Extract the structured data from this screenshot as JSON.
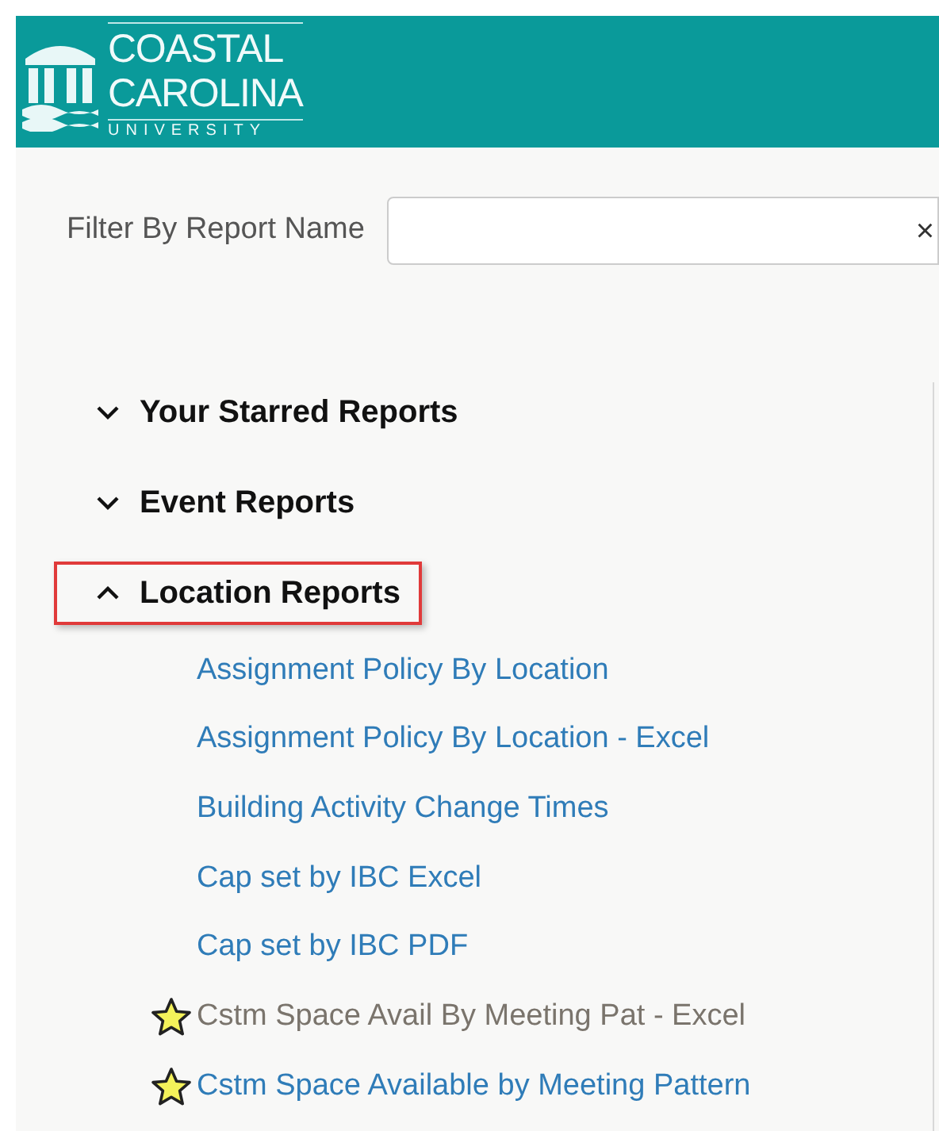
{
  "logo": {
    "lines": [
      "COASTAL",
      "CAROLINA",
      "UNIVERSITY"
    ]
  },
  "filter": {
    "label": "Filter By Report Name",
    "clear": "×"
  },
  "sections": [
    {
      "title": "Your Starred Reports",
      "expanded": false,
      "highlighted": false
    },
    {
      "title": "Event Reports",
      "expanded": false,
      "highlighted": false
    },
    {
      "title": "Location Reports",
      "expanded": true,
      "highlighted": true,
      "reports": [
        {
          "name": "Assignment Policy By Location",
          "starred": false,
          "visited": false
        },
        {
          "name": "Assignment Policy By Location - Excel",
          "starred": false,
          "visited": false
        },
        {
          "name": "Building Activity Change Times",
          "starred": false,
          "visited": false
        },
        {
          "name": "Cap set by IBC Excel",
          "starred": false,
          "visited": false
        },
        {
          "name": "Cap set by IBC PDF",
          "starred": false,
          "visited": false
        },
        {
          "name": "Cstm Space Avail By Meeting Pat - Excel",
          "starred": true,
          "visited": true
        },
        {
          "name": "Cstm Space Available by Meeting Pattern",
          "starred": true,
          "visited": false
        }
      ]
    }
  ]
}
